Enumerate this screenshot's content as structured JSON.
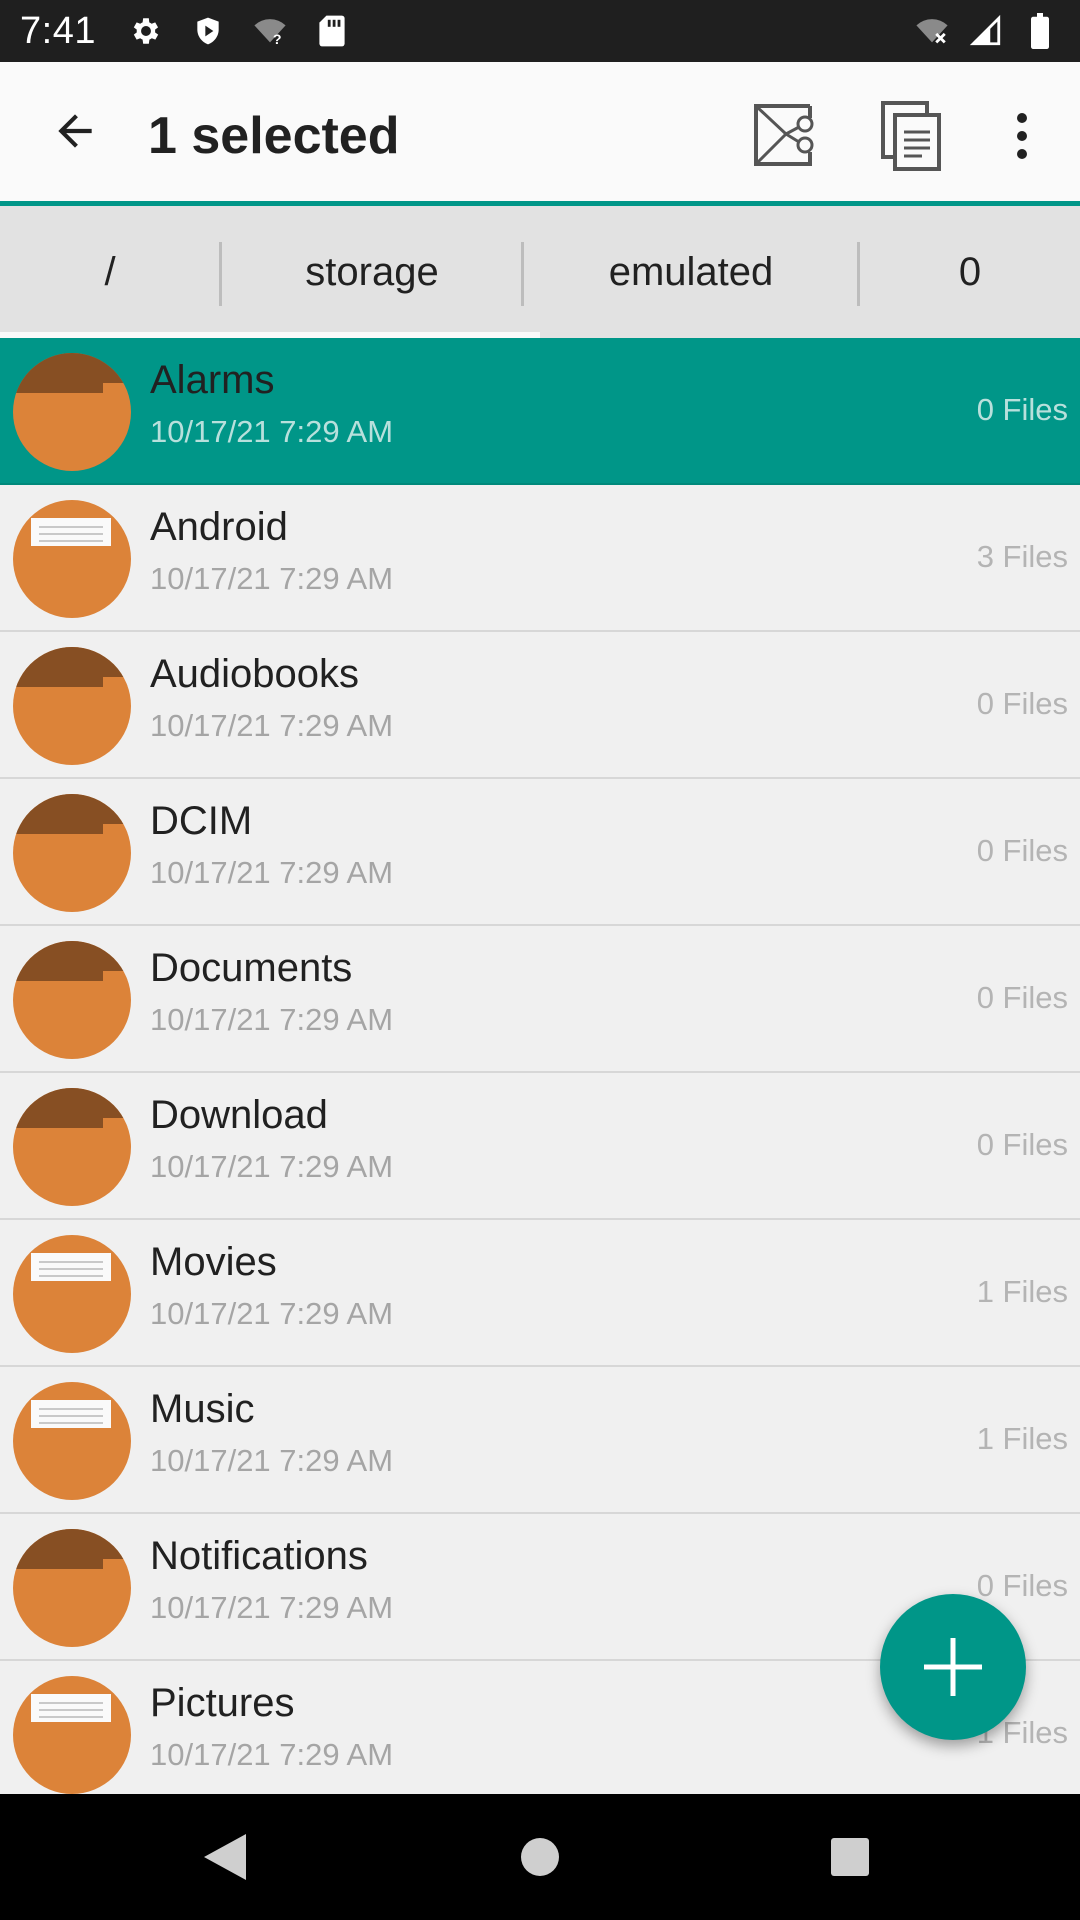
{
  "status_bar": {
    "time": "7:41",
    "left_icons": [
      "gear-icon",
      "shield-icon",
      "wifi-question-icon",
      "sd-card-icon"
    ],
    "right_icons": [
      "wifi-off-icon",
      "signal-icon",
      "battery-icon"
    ]
  },
  "app_bar": {
    "title": "1 selected",
    "accent_color": "#009688",
    "actions": [
      "cut-icon",
      "copy-icon",
      "more-vert-icon"
    ]
  },
  "breadcrumb": {
    "items": [
      "/",
      "storage",
      "emulated",
      "0"
    ]
  },
  "files": [
    {
      "name": "Alarms",
      "date": "10/17/21 7:29 AM",
      "count": "0 Files",
      "icon": "folder-icon",
      "selected": true
    },
    {
      "name": "Android",
      "date": "10/17/21 7:29 AM",
      "count": "3 Files",
      "icon": "folder-with-files-icon",
      "selected": false
    },
    {
      "name": "Audiobooks",
      "date": "10/17/21 7:29 AM",
      "count": "0 Files",
      "icon": "folder-icon",
      "selected": false
    },
    {
      "name": "DCIM",
      "date": "10/17/21 7:29 AM",
      "count": "0 Files",
      "icon": "folder-icon",
      "selected": false
    },
    {
      "name": "Documents",
      "date": "10/17/21 7:29 AM",
      "count": "0 Files",
      "icon": "folder-icon",
      "selected": false
    },
    {
      "name": "Download",
      "date": "10/17/21 7:29 AM",
      "count": "0 Files",
      "icon": "folder-icon",
      "selected": false
    },
    {
      "name": "Movies",
      "date": "10/17/21 7:29 AM",
      "count": "1 Files",
      "icon": "folder-with-files-icon",
      "selected": false
    },
    {
      "name": "Music",
      "date": "10/17/21 7:29 AM",
      "count": "1 Files",
      "icon": "folder-with-files-icon",
      "selected": false
    },
    {
      "name": "Notifications",
      "date": "10/17/21 7:29 AM",
      "count": "0 Files",
      "icon": "folder-icon",
      "selected": false
    },
    {
      "name": "Pictures",
      "date": "10/17/21 7:29 AM",
      "count": "1 Files",
      "icon": "folder-with-files-icon",
      "selected": false
    }
  ],
  "fab": {
    "icon": "plus-icon"
  },
  "nav_bar": {
    "icons": [
      "back-triangle-icon",
      "home-circle-icon",
      "recents-square-icon"
    ]
  }
}
